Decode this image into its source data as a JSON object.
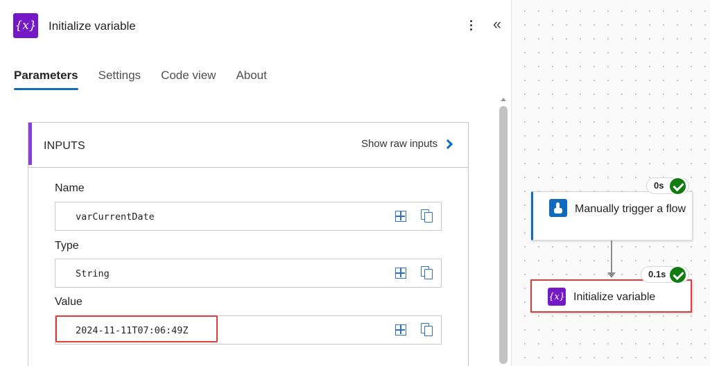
{
  "panel": {
    "title": "Initialize variable",
    "icon": "variable-icon",
    "menu_icon": "more-vertical-icon",
    "collapse_icon": "double-chevron-left-icon",
    "collapse_glyph": "«",
    "icon_glyph": "{x}",
    "tabs": [
      {
        "label": "Parameters",
        "active": true
      },
      {
        "label": "Settings",
        "active": false
      },
      {
        "label": "Code view",
        "active": false
      },
      {
        "label": "About",
        "active": false
      }
    ]
  },
  "inputs": {
    "title": "INPUTS",
    "show_raw_label": "Show raw inputs",
    "fields": [
      {
        "label": "Name",
        "value": "varCurrentDate"
      },
      {
        "label": "Type",
        "value": "String"
      },
      {
        "label": "Value",
        "value": "2024-11-11T07:06:49Z"
      }
    ]
  },
  "canvas": {
    "nodes": [
      {
        "label": "Manually trigger a flow",
        "duration": "0s",
        "status": "succeeded",
        "icon": "manual-trigger-icon"
      },
      {
        "label": "Initialize variable",
        "duration": "0.1s",
        "status": "succeeded",
        "icon": "variable-icon",
        "icon_glyph": "{x}"
      }
    ]
  },
  "colors": {
    "accent": "#0f6cbd",
    "variable": "#7519c7",
    "success": "#107c10",
    "highlight": "#e03a3a"
  }
}
